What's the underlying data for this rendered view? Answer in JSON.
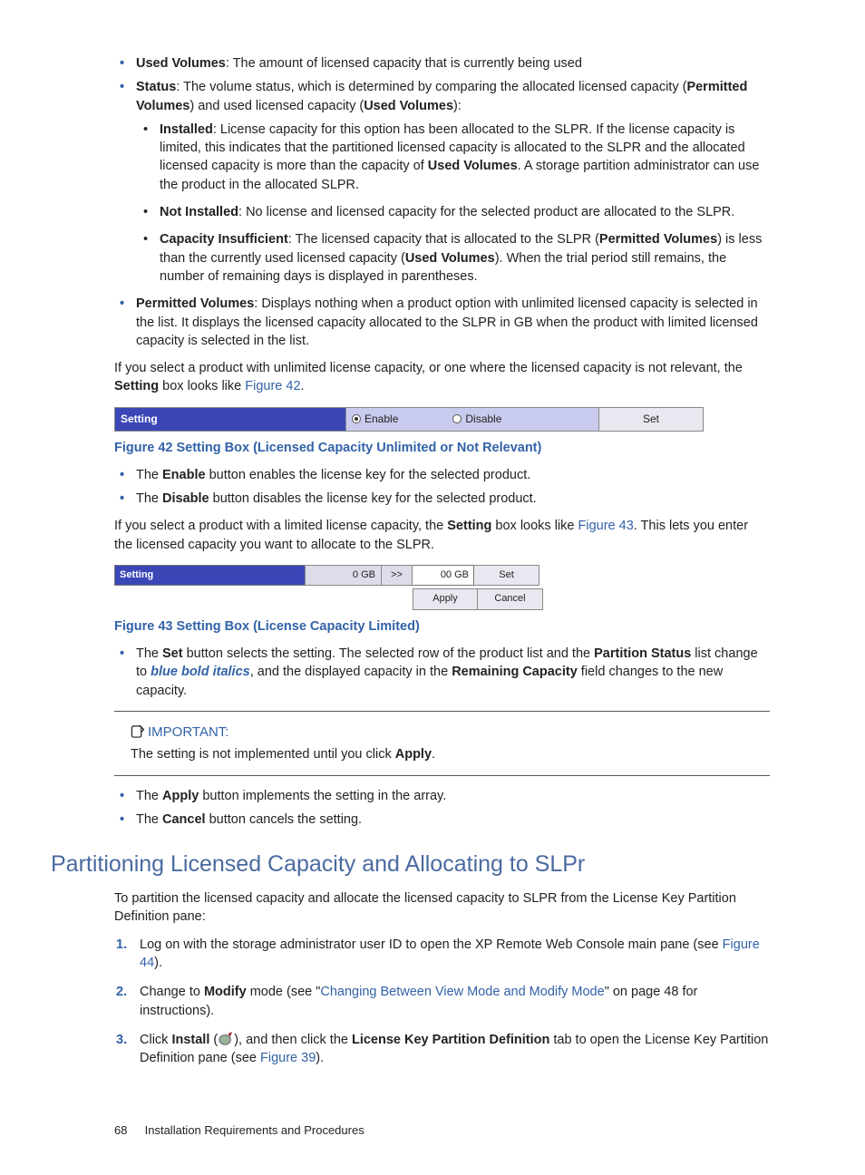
{
  "bullets1": {
    "used": {
      "term": "Used Volumes",
      "text": ": The amount of licensed capacity that is currently being used"
    },
    "status": {
      "term": "Status",
      "text": ": The volume status, which is determined by comparing the allocated licensed capacity (",
      "pv": "Permitted Volumes",
      "mid": ") and used licensed capacity (",
      "uv": "Used Volumes",
      "end": "):"
    },
    "installed": {
      "term": "Installed",
      "t1": ": License capacity for this option has been allocated to the SLPR. If the license capacity is limited, this indicates that the partitioned licensed capacity is allocated to the SLPR and the allocated licensed capacity is more than the capacity of ",
      "b1": "Used Volumes",
      "t2": ". A storage partition administrator can use the product in the allocated SLPR."
    },
    "notinstalled": {
      "term": "Not Installed",
      "text": ": No license and licensed capacity for the selected product are allocated to the SLPR."
    },
    "capins": {
      "term": "Capacity Insufficient",
      "t1": ": The licensed capacity that is allocated to the SLPR (",
      "b1": "Permitted Volumes",
      "t2": ") is less than the currently used licensed capacity (",
      "b2": "Used Volumes",
      "t3": "). When the trial period still remains, the number of remaining days is displayed in parentheses."
    },
    "permitted": {
      "term": "Permitted Volumes",
      "text": ": Displays nothing when a product option with unlimited licensed capacity is selected in the list. It displays the licensed capacity allocated to the SLPR in GB when the product with limited licensed capacity is selected in the list."
    }
  },
  "p1": {
    "a": "If you select a product with unlimited license capacity, or one where the licensed capacity is not relevant, the ",
    "b": "Setting",
    "c": " box looks like ",
    "link": "Figure 42",
    "d": "."
  },
  "fig42_bar": {
    "label": "Setting",
    "opt1": "Enable",
    "opt2": "Disable",
    "button": "Set"
  },
  "fig42_caption": "Figure 42 Setting Box (Licensed Capacity Unlimited or Not Relevant)",
  "bullets2": {
    "enable": {
      "a": "The ",
      "b": "Enable",
      "c": " button enables the license key for the selected product."
    },
    "disable": {
      "a": "The ",
      "b": "Disable",
      "c": " button disables the license key for the selected product."
    }
  },
  "p2": {
    "a": "If you select a product with a limited license capacity, the ",
    "b": "Setting",
    "c": " box looks like ",
    "link": "Figure 43",
    "d": ". This lets you enter the licensed capacity you want to allocate to the SLPR."
  },
  "fig43": {
    "label": "Setting",
    "val": "0 GB",
    "arrow": ">>",
    "input": "00 GB",
    "set": "Set",
    "apply": "Apply",
    "cancel": "Cancel"
  },
  "fig43_caption": "Figure 43 Setting Box (License Capacity Limited)",
  "bullets3": {
    "set": {
      "a": "The ",
      "b": "Set",
      "c": " button selects the setting. The selected row of the product list and the ",
      "d": "Partition Status",
      "e": " list change to ",
      "f": "blue bold italics",
      "g": ", and the displayed capacity in the ",
      "h": "Remaining Capacity",
      "i": " field changes to the new capacity."
    }
  },
  "important": {
    "label": "IMPORTANT:",
    "a": "The setting is not implemented until you click ",
    "b": "Apply",
    "c": "."
  },
  "bullets4": {
    "apply": {
      "a": "The ",
      "b": "Apply",
      "c": " button implements the setting in the array."
    },
    "cancel": {
      "a": "The ",
      "b": "Cancel",
      "c": " button cancels the setting."
    }
  },
  "h2": "Partitioning Licensed Capacity and Allocating to SLPr",
  "p3": "To partition the licensed capacity and allocate the licensed capacity to SLPR from the License Key Partition Definition pane:",
  "steps": {
    "s1": {
      "num": "1.",
      "a": "Log on with the storage administrator user ID to open the XP Remote Web Console main pane (see ",
      "link": "Figure 44",
      "b": ")."
    },
    "s2": {
      "num": "2.",
      "a": "Change to ",
      "b": "Modify",
      "c": " mode (see \"",
      "link": "Changing Between View Mode and Modify Mode",
      "d": "\" on page 48 for instructions)."
    },
    "s3": {
      "num": "3.",
      "a": "Click ",
      "b": "Install",
      "c": " (",
      "d": "), and then click the ",
      "e": "License Key Partition Definition",
      "f": " tab to open the License Key Partition Definition pane (see ",
      "link": "Figure 39",
      "g": ")."
    }
  },
  "footer": {
    "page": "68",
    "title": "Installation Requirements and Procedures"
  }
}
